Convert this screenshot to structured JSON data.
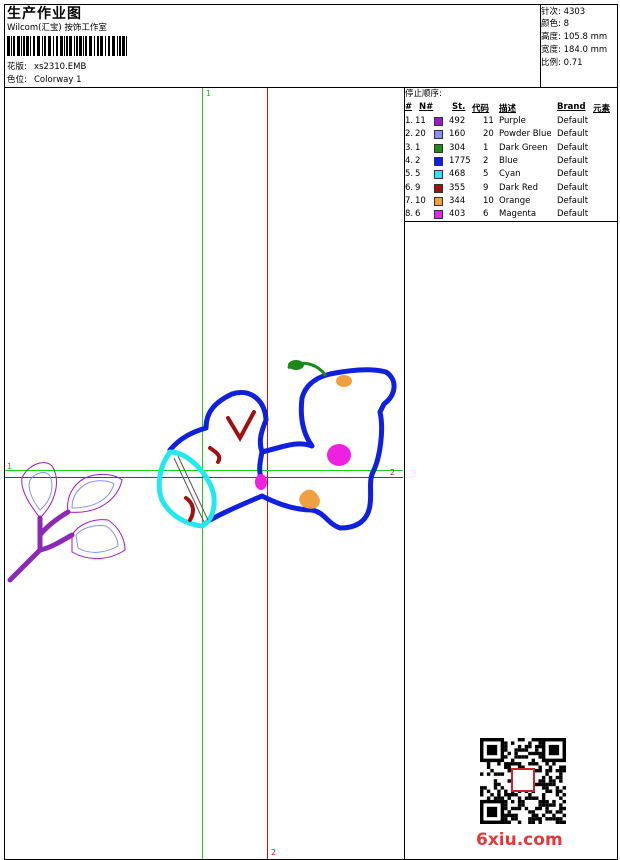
{
  "header": {
    "title": "生产作业图",
    "studio": "Wilcom(汇宝) 按饰工作室",
    "design_label": "花版:",
    "design_file": "xs2310.EMB",
    "colorway_label": "色位:",
    "colorway": "Colorway 1"
  },
  "stats": [
    {
      "label": "针次:",
      "value": "4303"
    },
    {
      "label": "颜色:",
      "value": "8"
    },
    {
      "label": "高度:",
      "value": "105.8 mm"
    },
    {
      "label": "宽度:",
      "value": "184.0 mm"
    },
    {
      "label": "比例:",
      "value": "0.71"
    }
  ],
  "sequence": {
    "title": "停止顺序:",
    "columns": [
      "#",
      "N#",
      "St.",
      "代码",
      "描述",
      "Brand",
      "元素"
    ],
    "rows": [
      {
        "idx": "1.",
        "n": "11",
        "color": "#9b1cc6",
        "st": "492",
        "code": "11",
        "desc": "Purple",
        "brand": "Default"
      },
      {
        "idx": "2.",
        "n": "20",
        "color": "#8c8cf0",
        "st": "160",
        "code": "20",
        "desc": "Powder Blue",
        "brand": "Default"
      },
      {
        "idx": "3.",
        "n": "1",
        "color": "#1b8a1b",
        "st": "304",
        "code": "1",
        "desc": "Dark Green",
        "brand": "Default"
      },
      {
        "idx": "4.",
        "n": "2",
        "color": "#1020e0",
        "st": "1775",
        "code": "2",
        "desc": "Blue",
        "brand": "Default"
      },
      {
        "idx": "5.",
        "n": "5",
        "color": "#22e8f0",
        "st": "468",
        "code": "5",
        "desc": "Cyan",
        "brand": "Default"
      },
      {
        "idx": "6.",
        "n": "9",
        "color": "#a01010",
        "st": "355",
        "code": "9",
        "desc": "Dark Red",
        "brand": "Default"
      },
      {
        "idx": "7.",
        "n": "10",
        "color": "#f0a040",
        "st": "344",
        "code": "10",
        "desc": "Orange",
        "brand": "Default"
      },
      {
        "idx": "8.",
        "n": "6",
        "color": "#f020e0",
        "st": "403",
        "code": "6",
        "desc": "Magenta",
        "brand": "Default"
      }
    ]
  },
  "guides": {
    "v1_label": "1",
    "h1_label": "1",
    "h2_label": "2",
    "v2_label": "2",
    "green": "#22cc22",
    "red": "#cc1111"
  },
  "watermark": "6xiu.com"
}
